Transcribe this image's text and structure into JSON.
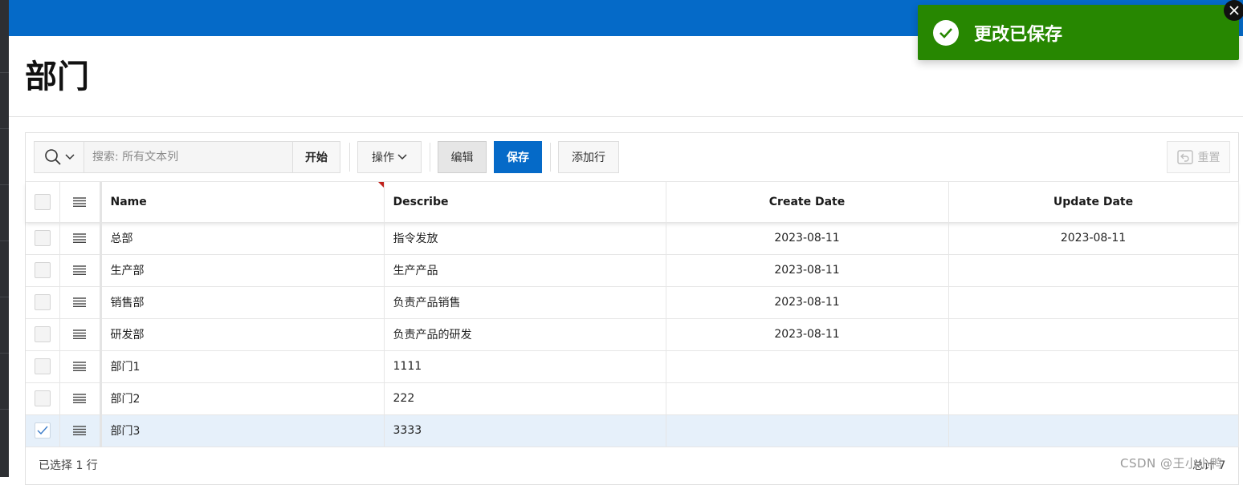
{
  "page": {
    "title": "部门"
  },
  "toolbar": {
    "search_placeholder": "搜索: 所有文本列",
    "go_label": "开始",
    "actions_label": "操作",
    "edit_label": "编辑",
    "save_label": "保存",
    "add_row_label": "添加行",
    "reset_label": "重置"
  },
  "table": {
    "columns": [
      "Name",
      "Describe",
      "Create Date",
      "Update Date"
    ],
    "rows": [
      {
        "name": "总部",
        "describe": "指令发放",
        "create_date": "2023-08-11",
        "update_date": "2023-08-11",
        "selected": false
      },
      {
        "name": "生产部",
        "describe": "生产产品",
        "create_date": "2023-08-11",
        "update_date": "",
        "selected": false
      },
      {
        "name": "销售部",
        "describe": "负责产品销售",
        "create_date": "2023-08-11",
        "update_date": "",
        "selected": false
      },
      {
        "name": "研发部",
        "describe": "负责产品的研发",
        "create_date": "2023-08-11",
        "update_date": "",
        "selected": false
      },
      {
        "name": "部门1",
        "describe": "1111",
        "create_date": "",
        "update_date": "",
        "selected": false
      },
      {
        "name": "部门2",
        "describe": "222",
        "create_date": "",
        "update_date": "",
        "selected": false
      },
      {
        "name": "部门3",
        "describe": "3333",
        "create_date": "",
        "update_date": "",
        "selected": true
      }
    ]
  },
  "footer": {
    "selected_text": "已选择 1 行",
    "total_text": "总计 7"
  },
  "toast": {
    "message": "更改已保存"
  },
  "watermark": "CSDN @王小小鸭",
  "colors": {
    "brand_blue": "#056ac8",
    "success_green": "#278701",
    "selected_row": "#e6f0fa"
  },
  "icons": {
    "search": "search-icon",
    "dropdown": "chevron-down-icon",
    "row_menu": "hamburger-menu-icon",
    "reset": "reset-icon",
    "toast": "check-circle-icon",
    "close": "close-icon"
  }
}
